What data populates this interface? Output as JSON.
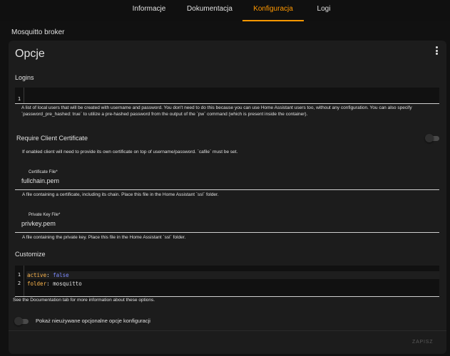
{
  "tabs": [
    {
      "label": "Informacje",
      "active": false
    },
    {
      "label": "Dokumentacja",
      "active": false
    },
    {
      "label": "Konfiguracja",
      "active": true
    },
    {
      "label": "Logi",
      "active": false
    }
  ],
  "app_title": "Mosquitto broker",
  "card": {
    "title": "Opcje",
    "logins": {
      "label": "Logins",
      "line_numbers": [
        "1"
      ],
      "description": "A list of local users that will be created with username and password. You don't need to do this because you can use Home Assistant users too, without any configuration. You can also specify `password_pre_hashed: true` to utilize a pre-hashed password from the output of the `pw` command (which is present inside the container)."
    },
    "require_cert": {
      "label": "Require Client Certificate",
      "enabled": false,
      "description": "If enabled client will need to provide its own certificate on top of username/password. `cafile` must be set."
    },
    "certfile": {
      "label": "Certificate File*",
      "value": "fullchain.pem",
      "description": "A file containing a certificate, including its chain. Place this file in the Home Assistant `ssl` folder."
    },
    "keyfile": {
      "label": "Private Key File*",
      "value": "privkey.pem",
      "description": "A file containing the private key. Place this file in the Home Assistant `ssl` folder."
    },
    "customize": {
      "label": "Customize",
      "line_numbers": [
        "1",
        "2"
      ],
      "lines": [
        {
          "key": "active",
          "sep": ": ",
          "value": "false"
        },
        {
          "key": "folder",
          "sep": ": ",
          "value": "mosquitto"
        }
      ],
      "description": "See the Documentation tab for more information about these options."
    },
    "show_unused": {
      "label": "Pokaż nieużywane opcjonalne opcje konfiguracji",
      "enabled": false
    },
    "save_label": "ZAPISZ"
  },
  "colors": {
    "accent": "#ff9800",
    "background": "#111111",
    "card": "#1c1c1c",
    "yaml_key": "#ffb74d",
    "yaml_bool": "#7e8cff"
  }
}
